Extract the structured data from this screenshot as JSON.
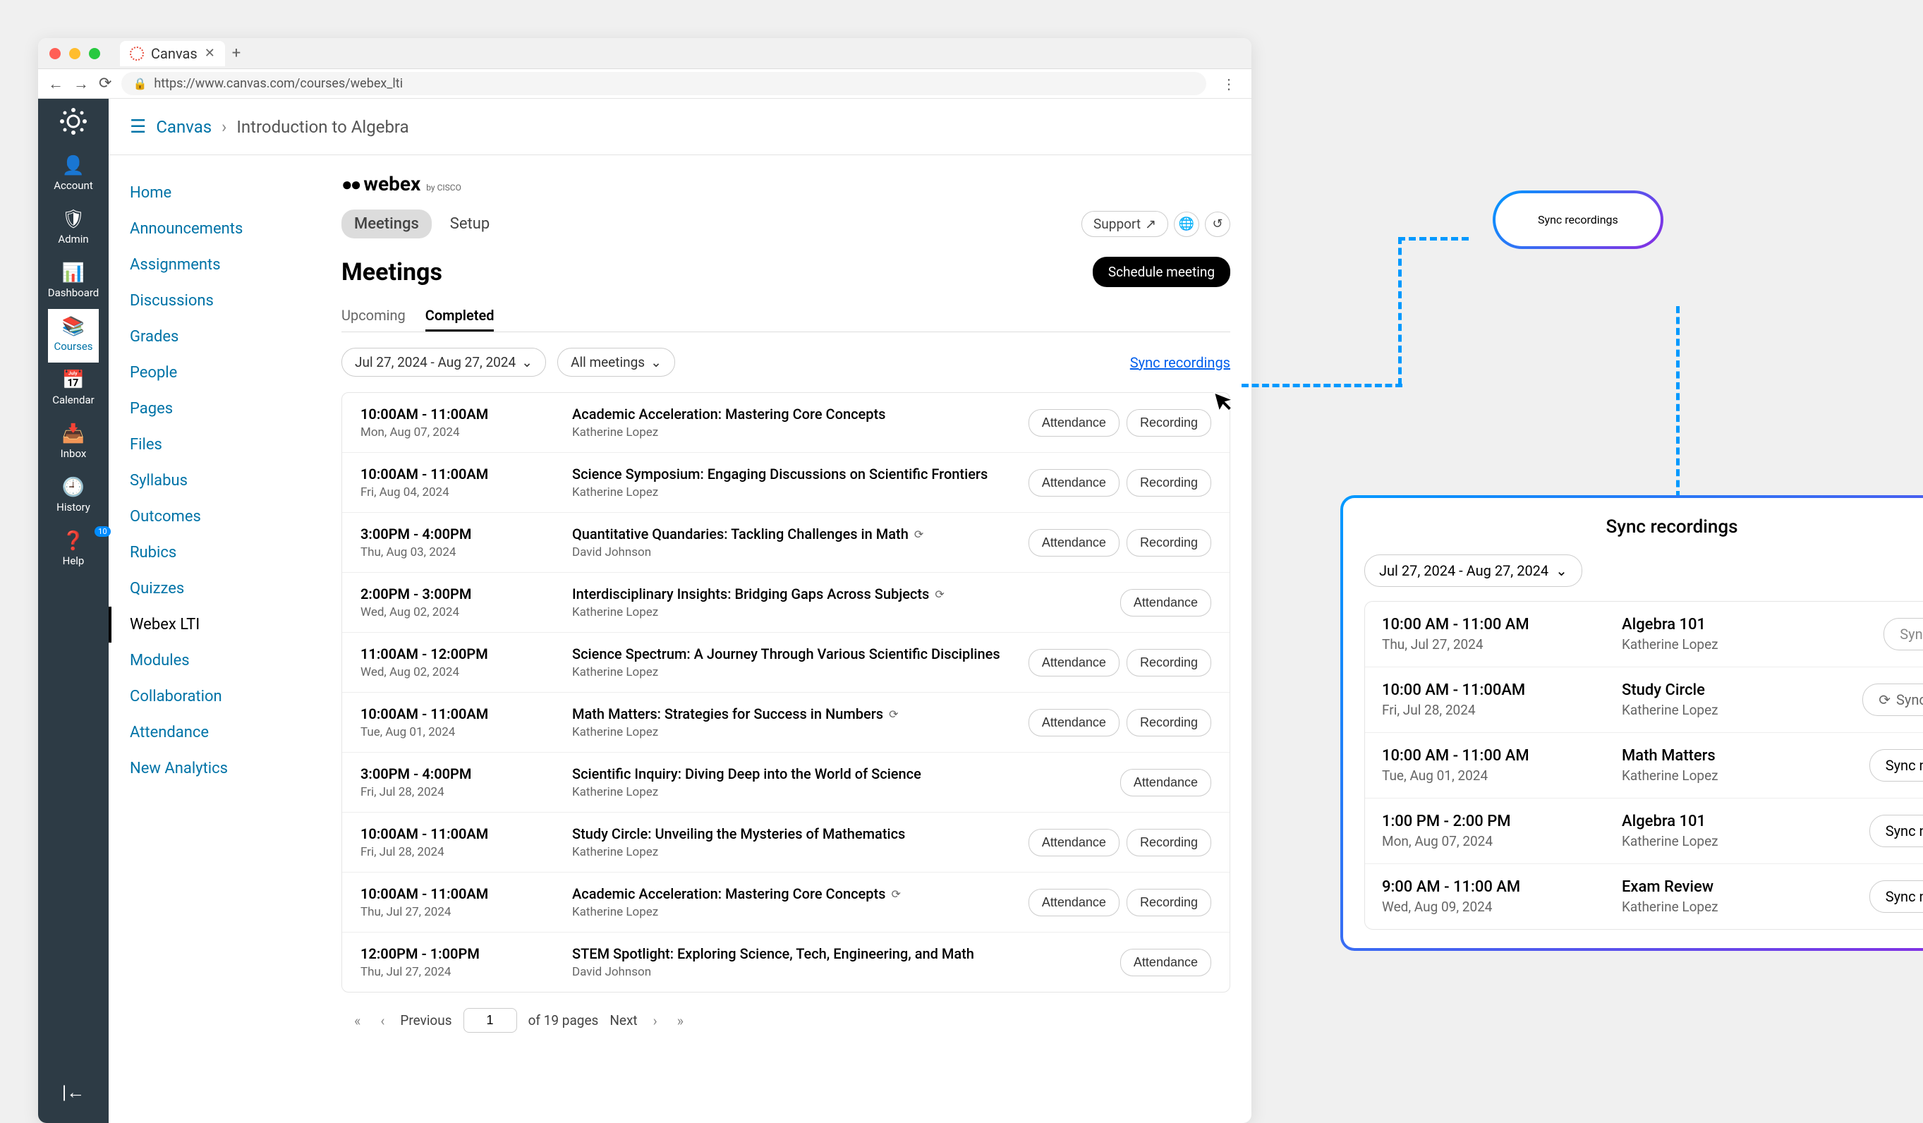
{
  "browser": {
    "tab_title": "Canvas",
    "url": "https://www.canvas.com/courses/webex_lti"
  },
  "rail": {
    "items": [
      {
        "label": "Account"
      },
      {
        "label": "Admin"
      },
      {
        "label": "Dashboard"
      },
      {
        "label": "Courses"
      },
      {
        "label": "Calendar"
      },
      {
        "label": "Inbox"
      },
      {
        "label": "History"
      },
      {
        "label": "Help"
      }
    ],
    "help_badge": "10"
  },
  "breadcrumb": {
    "root": "Canvas",
    "current": "Introduction to Algebra"
  },
  "course_nav": [
    "Home",
    "Announcements",
    "Assignments",
    "Discussions",
    "Grades",
    "People",
    "Pages",
    "Files",
    "Syllabus",
    "Outcomes",
    "Rubics",
    "Quizzes",
    "Webex LTI",
    "Modules",
    "Collaboration",
    "Attendance",
    "New Analytics"
  ],
  "webex": {
    "brand": "webex",
    "by": "by CISCO"
  },
  "tabs": {
    "meetings": "Meetings",
    "setup": "Setup",
    "support": "Support"
  },
  "meetings": {
    "title": "Meetings",
    "schedule": "Schedule meeting",
    "subtabs": {
      "upcoming": "Upcoming",
      "completed": "Completed"
    },
    "date_range": "Jul 27, 2024 - Aug 27, 2024",
    "filter": "All meetings",
    "sync": "Sync recordings"
  },
  "list": [
    {
      "time": "10:00AM - 11:00AM",
      "date": "Mon, Aug 07, 2024",
      "title": "Academic Acceleration: Mastering Core Concepts",
      "host": "Katherine Lopez",
      "recur": false,
      "attendance": true,
      "recording": true
    },
    {
      "time": "10:00AM - 11:00AM",
      "date": "Fri, Aug 04, 2024",
      "title": "Science Symposium: Engaging Discussions on Scientific Frontiers",
      "host": "Katherine Lopez",
      "recur": false,
      "attendance": true,
      "recording": true
    },
    {
      "time": "3:00PM - 4:00PM",
      "date": "Thu, Aug 03, 2024",
      "title": "Quantitative Quandaries: Tackling Challenges in Math",
      "host": "David Johnson",
      "recur": true,
      "attendance": true,
      "recording": true
    },
    {
      "time": "2:00PM - 3:00PM",
      "date": "Wed, Aug 02, 2024",
      "title": "Interdisciplinary Insights: Bridging Gaps Across Subjects",
      "host": "Katherine Lopez",
      "recur": true,
      "attendance": true,
      "recording": false
    },
    {
      "time": "11:00AM - 12:00PM",
      "date": "Wed, Aug 02, 2024",
      "title": "Science Spectrum: A Journey Through Various Scientific Disciplines",
      "host": "Katherine Lopez",
      "recur": false,
      "attendance": true,
      "recording": true
    },
    {
      "time": "10:00AM - 11:00AM",
      "date": "Tue, Aug 01, 2024",
      "title": "Math Matters: Strategies for Success in Numbers",
      "host": "Katherine Lopez",
      "recur": true,
      "attendance": true,
      "recording": true
    },
    {
      "time": "3:00PM - 4:00PM",
      "date": "Fri, Jul 28, 2024",
      "title": "Scientific Inquiry: Diving Deep into the World of Science",
      "host": "Katherine Lopez",
      "recur": false,
      "attendance": true,
      "recording": false
    },
    {
      "time": "10:00AM - 11:00AM",
      "date": "Fri, Jul 28, 2024",
      "title": "Study Circle: Unveiling the Mysteries of Mathematics",
      "host": "Katherine Lopez",
      "recur": false,
      "attendance": true,
      "recording": true
    },
    {
      "time": "10:00AM - 11:00AM",
      "date": "Thu, Jul 27, 2024",
      "title": "Academic Acceleration: Mastering Core Concepts",
      "host": "Katherine Lopez",
      "recur": true,
      "attendance": true,
      "recording": true
    },
    {
      "time": "12:00PM - 1:00PM",
      "date": "Thu, Jul 27, 2024",
      "title": "STEM Spotlight: Exploring Science, Tech, Engineering, and Math",
      "host": "David Johnson",
      "recur": false,
      "attendance": true,
      "recording": false
    }
  ],
  "buttons": {
    "attendance": "Attendance",
    "recording": "Recording"
  },
  "pagination": {
    "previous": "Previous",
    "page": "1",
    "of": "of 19 pages",
    "next": "Next"
  },
  "callout": {
    "label": "Sync recordings"
  },
  "dialog": {
    "title": "Sync recordings",
    "date_range": "Jul 27, 2024 - Aug 27, 2024",
    "rows": [
      {
        "time": "10:00 AM - 11:00 AM",
        "date": "Thu, Jul 27, 2024",
        "title": "Algebra 101",
        "host": "Katherine Lopez",
        "status": "Synced"
      },
      {
        "time": "10:00 AM - 11:00AM",
        "date": "Fri, Jul 28, 2024",
        "title": "Study Circle",
        "host": "Katherine Lopez",
        "status": "Syncing"
      },
      {
        "time": "10:00 AM - 11:00 AM",
        "date": "Tue, Aug 01, 2024",
        "title": "Math Matters",
        "host": "Katherine Lopez",
        "status": "Sync now"
      },
      {
        "time": "1:00 PM - 2:00 PM",
        "date": "Mon, Aug 07, 2024",
        "title": "Algebra 101",
        "host": "Katherine Lopez",
        "status": "Sync now"
      },
      {
        "time": "9:00 AM - 11:00 AM",
        "date": "Wed, Aug 09, 2024",
        "title": "Exam Review",
        "host": "Katherine Lopez",
        "status": "Sync now"
      }
    ]
  }
}
